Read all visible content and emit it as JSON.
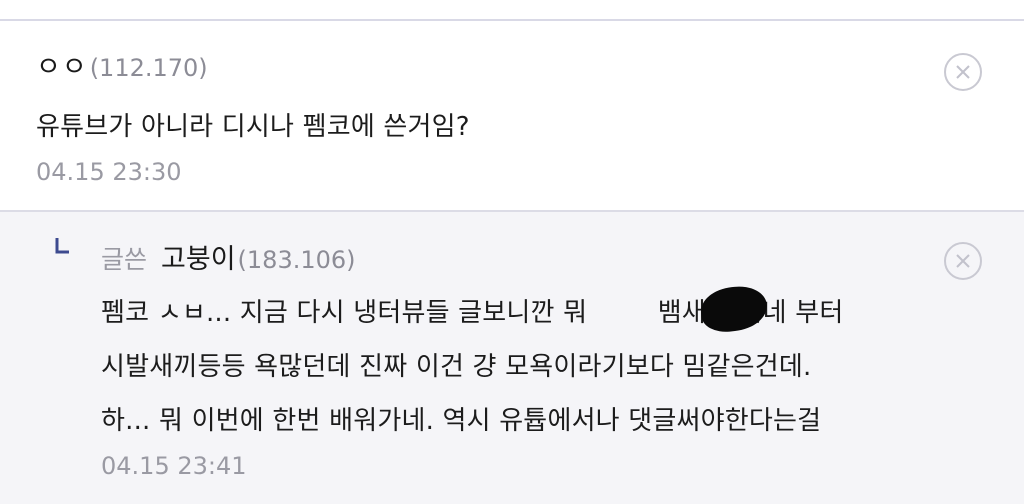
{
  "comment": {
    "nickname": "ㅇㅇ",
    "ip": "(112.170)",
    "text": "유튜브가 아니라 디시나 펨코에 쓴거임?",
    "date": "04.15 23:30",
    "delete_icon": "close-circle-icon"
  },
  "reply": {
    "reply_icon": "reply-arrow-icon",
    "writer_tag": "글쓴",
    "nickname": "고붕이",
    "ip": "(183.106)",
    "line1_a": "펨코 ㅅㅂ... 지금 다시 냉터뷰들 글보니깐 뭐 ",
    "line1_b": "뱀새끼 맞네 부터",
    "line2": "시발새끼등등 욕많던데 진짜 이건 걍 모욕이라기보다 밈같은건데.",
    "line3": "하... 뭐 이번에 한번 배워가네. 역시 유튭에서나 댓글써야한다는걸",
    "date": "04.15 23:41",
    "delete_icon": "close-circle-icon",
    "redaction": "redaction-blot"
  }
}
